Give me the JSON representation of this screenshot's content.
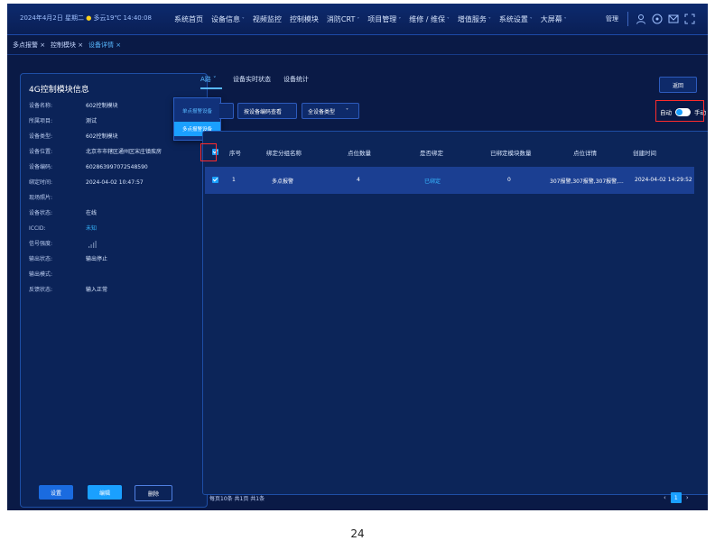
{
  "header": {
    "datetime": "2024年4月2日 星期二",
    "weather": "多云19℃",
    "time": "14:40:08",
    "nav": [
      "系统首页",
      "设备信息",
      "视频监控",
      "控制模块",
      "消防CRT",
      "项目管理",
      "维修 / 维保",
      "增值服务",
      "系统设置",
      "大屏幕"
    ],
    "user": "管理"
  },
  "breadcrumb": [
    "多点报警 ×",
    "控制模块 ×",
    "设备详情 ×"
  ],
  "device_panel": {
    "title": "4G控制模块信息",
    "rows": [
      {
        "k": "设备名称:",
        "v": "602控制模块"
      },
      {
        "k": "所属项目:",
        "v": "测试"
      },
      {
        "k": "设备类型:",
        "v": "602控制模块"
      },
      {
        "k": "设备位置:",
        "v": "北京市市辖区通州区宋庄镇疾房"
      },
      {
        "k": "设备编码:",
        "v": "6028639970725485​90"
      },
      {
        "k": "绑定时间:",
        "v": "2024-04-02 10:47:57"
      },
      {
        "k": "现场照片:",
        "v": ""
      },
      {
        "k": "设备状态:",
        "v": "在线"
      },
      {
        "k": "ICCID:",
        "v": "未知"
      },
      {
        "k": "信号强度:",
        "v": ""
      },
      {
        "k": "输出状态:",
        "v": "输出停止"
      },
      {
        "k": "输出模式:",
        "v": ""
      },
      {
        "k": "反馈状态:",
        "v": "输入正常"
      }
    ],
    "buttons": [
      "设置",
      "编辑",
      "删除"
    ]
  },
  "tabs": [
    "A路",
    "设备实时状态",
    "设备统计"
  ],
  "dropdown": [
    "单点报警设备",
    "多点报警设备"
  ],
  "filters": [
    "按设备编码查看",
    "全设备类型"
  ],
  "return_label": "返回",
  "mode": {
    "auto": "自动",
    "manual": "手动"
  },
  "table": {
    "headers": [
      "序号",
      "绑定分组名称",
      "点位数量",
      "是否绑定",
      "已绑定模块数量",
      "点位详情",
      "创建时间"
    ],
    "rows": [
      {
        "idx": "1",
        "name": "多点报警",
        "count": "4",
        "bound": "已绑定",
        "modules": "0",
        "detail": "307报警,307报警,307报警,...",
        "created": "2024-04-02 14:29:52"
      }
    ]
  },
  "footer": "每页10条 共1页 共1条",
  "pager": {
    "prev": "‹",
    "current": "1",
    "next": "›"
  },
  "page_number": "24",
  "colors": {
    "bg": "#0a1a46",
    "accent": "#1aa0ff",
    "highlight": "#ff2b2b"
  }
}
